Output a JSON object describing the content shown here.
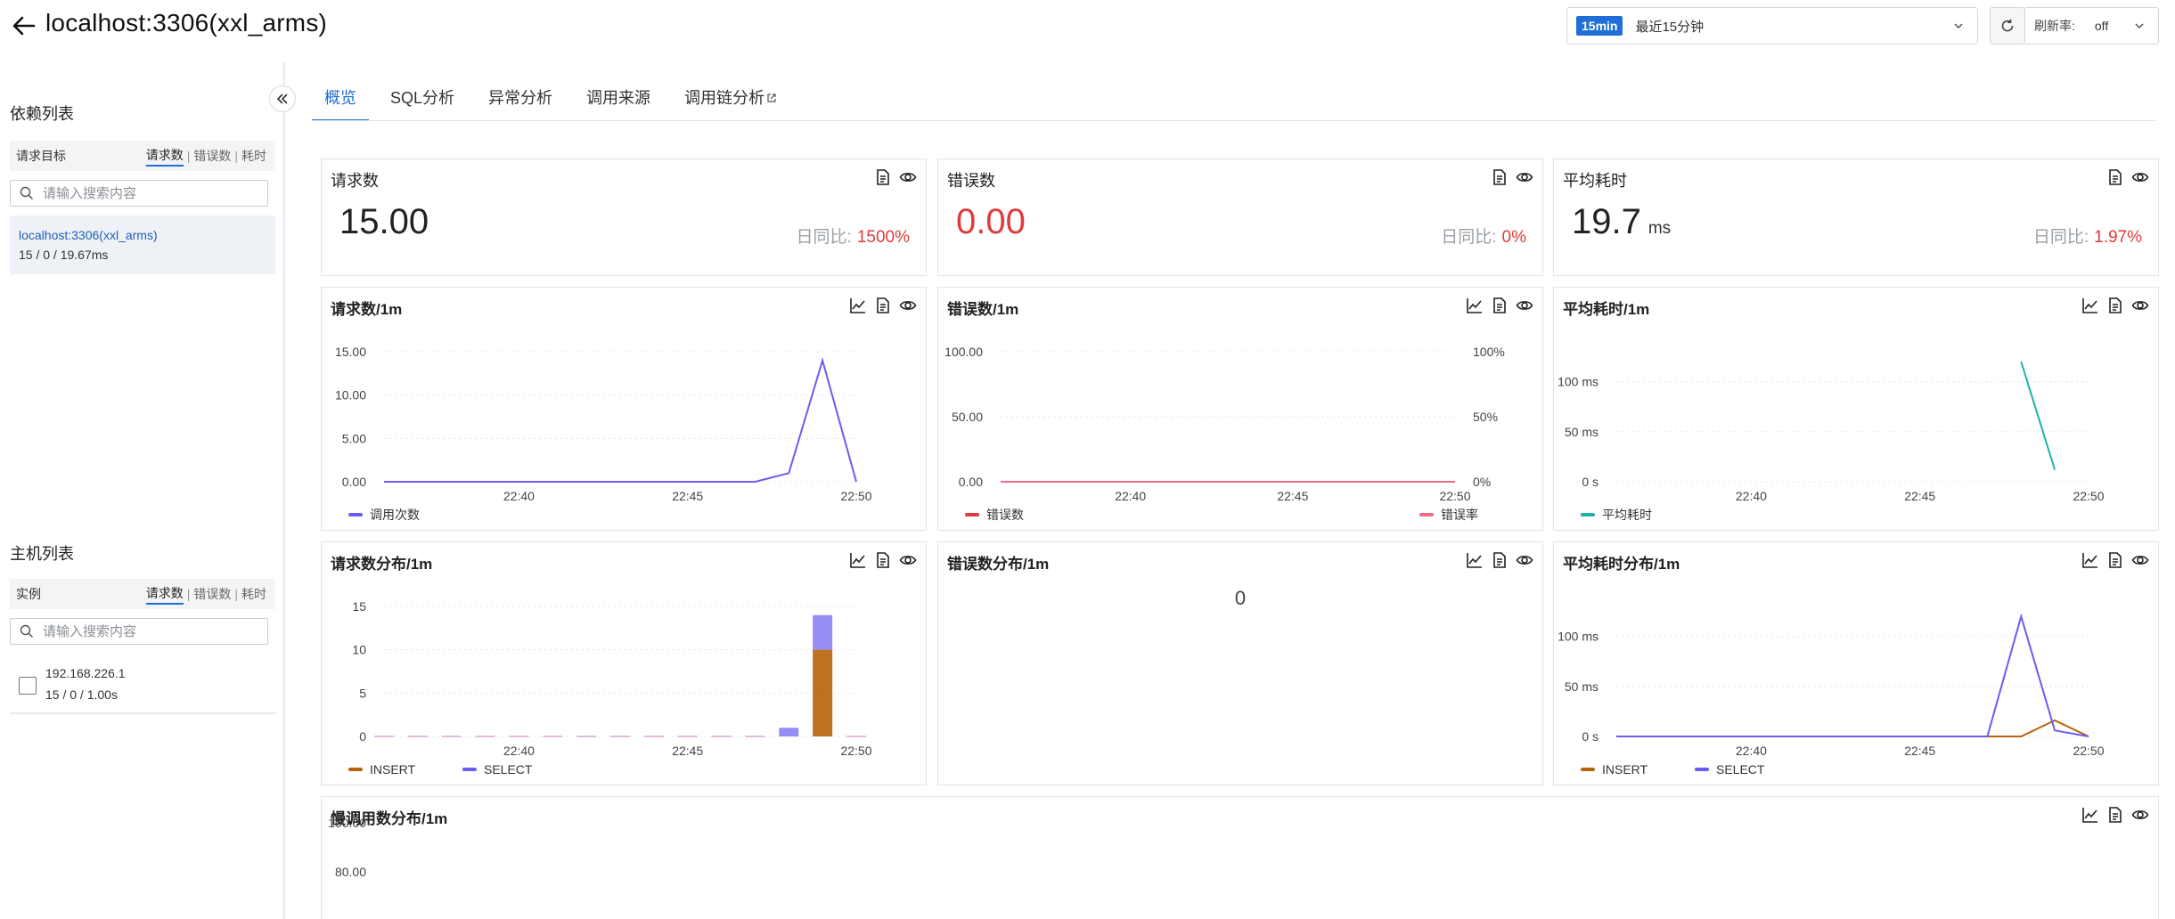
{
  "header": {
    "title": "localhost:3306(xxl_arms)",
    "time_badge": "15min",
    "time_label": "最近15分钟",
    "refresh_rate_label": "刷新率:",
    "refresh_rate_value": "off"
  },
  "sidebar": {
    "dependency_title": "依赖列表",
    "dependency_col": "请求目标",
    "sort_options": [
      "请求数",
      "错误数",
      "耗时"
    ],
    "search_placeholder": "请输入搜索内容",
    "dependency_item": {
      "name": "localhost:3306(xxl_arms)",
      "stats": "15 / 0 / 19.67ms"
    },
    "host_title": "主机列表",
    "host_col": "实例",
    "host_item": {
      "ip": "192.168.226.1",
      "stats": "15 / 0 / 1.00s"
    }
  },
  "tabs": [
    "概览",
    "SQL分析",
    "异常分析",
    "调用来源",
    "调用链分析"
  ],
  "summary": {
    "requests": {
      "title": "请求数",
      "value": "15.00",
      "compare_label": "日同比:",
      "compare_value": "1500%"
    },
    "errors": {
      "title": "错误数",
      "value": "0.00",
      "compare_label": "日同比:",
      "compare_value": "0%"
    },
    "avg_time": {
      "title": "平均耗时",
      "value": "19.7",
      "unit": "ms",
      "compare_label": "日同比:",
      "compare_value": "1.97%"
    }
  },
  "colors": {
    "accent": "#1f6fd6",
    "purple": "#6a5cf0",
    "red": "#e03b3b",
    "pink": "#f06a8a",
    "teal": "#1fb3a8",
    "orange": "#b8620a"
  },
  "chart_data": [
    {
      "type": "line",
      "title": "请求数/1m",
      "x": [
        "22:36",
        "22:37",
        "22:38",
        "22:39",
        "22:40",
        "22:41",
        "22:42",
        "22:43",
        "22:44",
        "22:45",
        "22:46",
        "22:47",
        "22:48",
        "22:49",
        "22:50"
      ],
      "xticks": [
        "22:40",
        "22:45",
        "22:50"
      ],
      "yticks": [
        "0.00",
        "5.00",
        "10.00",
        "15.00"
      ],
      "ylim": [
        0,
        15
      ],
      "series": [
        {
          "name": "调用次数",
          "values": [
            0,
            0,
            0,
            0,
            0,
            0,
            0,
            0,
            0,
            0,
            0,
            0,
            1,
            14,
            0
          ]
        }
      ]
    },
    {
      "type": "line",
      "title": "错误数/1m",
      "x": [
        "22:36",
        "22:37",
        "22:38",
        "22:39",
        "22:40",
        "22:41",
        "22:42",
        "22:43",
        "22:44",
        "22:45",
        "22:46",
        "22:47",
        "22:48",
        "22:49",
        "22:50"
      ],
      "xticks": [
        "22:40",
        "22:45",
        "22:50"
      ],
      "yticks": [
        "0.00",
        "50.00",
        "100.00"
      ],
      "yticks_right": [
        "0%",
        "50%",
        "100%"
      ],
      "ylim": [
        0,
        100
      ],
      "series": [
        {
          "name": "错误数",
          "values": [
            0,
            0,
            0,
            0,
            0,
            0,
            0,
            0,
            0,
            0,
            0,
            0,
            0,
            0,
            0
          ]
        },
        {
          "name": "错误率",
          "values": [
            0,
            0,
            0,
            0,
            0,
            0,
            0,
            0,
            0,
            0,
            0,
            0,
            0,
            0,
            0
          ]
        }
      ]
    },
    {
      "type": "line",
      "title": "平均耗时/1m",
      "x": [
        "22:36",
        "22:37",
        "22:38",
        "22:39",
        "22:40",
        "22:41",
        "22:42",
        "22:43",
        "22:44",
        "22:45",
        "22:46",
        "22:47",
        "22:48",
        "22:49",
        "22:50"
      ],
      "xticks": [
        "22:40",
        "22:45",
        "22:50"
      ],
      "yticks": [
        "0 s",
        "50 ms",
        "100 ms"
      ],
      "ylim": [
        0,
        130
      ],
      "series": [
        {
          "name": "平均耗时",
          "values": [
            null,
            null,
            null,
            null,
            null,
            null,
            null,
            null,
            null,
            null,
            null,
            null,
            120,
            12,
            null
          ]
        }
      ]
    },
    {
      "type": "bar",
      "title": "请求数分布/1m",
      "x": [
        "22:36",
        "22:37",
        "22:38",
        "22:39",
        "22:40",
        "22:41",
        "22:42",
        "22:43",
        "22:44",
        "22:45",
        "22:46",
        "22:47",
        "22:48",
        "22:49",
        "22:50"
      ],
      "xticks": [
        "22:40",
        "22:45",
        "22:50"
      ],
      "yticks": [
        "0",
        "5",
        "10",
        "15"
      ],
      "ylim": [
        0,
        15
      ],
      "series": [
        {
          "name": "INSERT",
          "values": [
            0,
            0,
            0,
            0,
            0,
            0,
            0,
            0,
            0,
            0,
            0,
            0,
            0,
            10,
            0
          ]
        },
        {
          "name": "SELECT",
          "values": [
            0,
            0,
            0,
            0,
            0,
            0,
            0,
            0,
            0,
            0,
            0,
            0,
            1,
            4,
            0
          ]
        }
      ]
    },
    {
      "type": "bar",
      "title": "错误数分布/1m",
      "center_text": "0"
    },
    {
      "type": "line",
      "title": "平均耗时分布/1m",
      "x": [
        "22:36",
        "22:37",
        "22:38",
        "22:39",
        "22:40",
        "22:41",
        "22:42",
        "22:43",
        "22:44",
        "22:45",
        "22:46",
        "22:47",
        "22:48",
        "22:49",
        "22:50"
      ],
      "xticks": [
        "22:40",
        "22:45",
        "22:50"
      ],
      "yticks": [
        "0 s",
        "50 ms",
        "100 ms"
      ],
      "ylim": [
        0,
        130
      ],
      "series": [
        {
          "name": "INSERT",
          "values": [
            0,
            0,
            0,
            0,
            0,
            0,
            0,
            0,
            0,
            0,
            0,
            0,
            0,
            16,
            0
          ]
        },
        {
          "name": "SELECT",
          "values": [
            0,
            0,
            0,
            0,
            0,
            0,
            0,
            0,
            0,
            0,
            0,
            0,
            120,
            6,
            0
          ]
        }
      ]
    },
    {
      "type": "line",
      "title": "慢调用数分布/1m",
      "yticks": [
        "80.00",
        "100.00"
      ],
      "ylim": [
        0,
        100
      ]
    }
  ]
}
